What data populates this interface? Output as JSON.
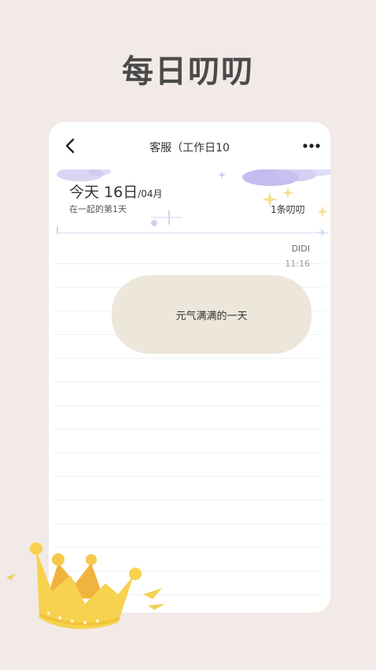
{
  "hero": {
    "title": "每日叨叨"
  },
  "topbar": {
    "title": "客服（工作日10"
  },
  "header": {
    "today_label": "今天 16日",
    "month_label": "/04月",
    "together_text": "在一起的第1天",
    "count_text": "1条叨叨"
  },
  "message": {
    "sender": "DIDI",
    "time": "11:16",
    "text": "元气满满的一天"
  },
  "icons": {
    "back": "chevron-left-icon",
    "more": "more-dots-icon",
    "crown": "crown-icon"
  },
  "colors": {
    "background": "#f1eae7",
    "bubble": "#ede6db",
    "cloud": "#c9c3f0",
    "star": "#f3e08a",
    "crown": "#f5c84a"
  }
}
